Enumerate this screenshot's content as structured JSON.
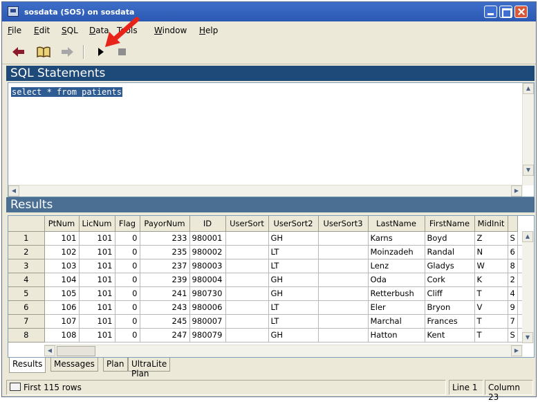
{
  "window": {
    "title": "sosdata (SOS) on sosdata"
  },
  "menu": [
    "File",
    "Edit",
    "SQL",
    "Data",
    "Tools",
    "Window",
    "Help"
  ],
  "toolbar": {
    "icons": [
      "back-arrow-icon",
      "book-icon",
      "forward-arrow-icon",
      "play-icon",
      "stop-icon"
    ]
  },
  "sql_panel": {
    "title": "SQL Statements",
    "query": "select * from patients"
  },
  "results_panel": {
    "title": "Results",
    "columns": [
      "PtNum",
      "LicNum",
      "Flag",
      "PayorNum",
      "ID",
      "UserSort",
      "UserSort2",
      "UserSort3",
      "LastName",
      "FirstName",
      "MidInit",
      ""
    ],
    "rows": [
      {
        "n": "1",
        "cells": [
          "101",
          "101",
          "0",
          "233",
          "980001",
          "",
          "GH",
          "",
          "Karns",
          "Boyd",
          "Z",
          "S"
        ]
      },
      {
        "n": "2",
        "cells": [
          "102",
          "101",
          "0",
          "235",
          "980002",
          "",
          "LT",
          "",
          "Moinzadeh",
          "Randal",
          "N",
          "6"
        ]
      },
      {
        "n": "3",
        "cells": [
          "103",
          "101",
          "0",
          "237",
          "980003",
          "",
          "LT",
          "",
          "Lenz",
          "Gladys",
          "W",
          "8"
        ]
      },
      {
        "n": "4",
        "cells": [
          "104",
          "101",
          "0",
          "239",
          "980004",
          "",
          "GH",
          "",
          "Oda",
          "Cork",
          "K",
          "2"
        ]
      },
      {
        "n": "5",
        "cells": [
          "105",
          "101",
          "0",
          "241",
          "980730",
          "",
          "GH",
          "",
          "Retterbush",
          "Cliff",
          "T",
          "4"
        ]
      },
      {
        "n": "6",
        "cells": [
          "106",
          "101",
          "0",
          "243",
          "980006",
          "",
          "LT",
          "",
          "Eler",
          "Bryon",
          "V",
          "9"
        ]
      },
      {
        "n": "7",
        "cells": [
          "107",
          "101",
          "0",
          "245",
          "980007",
          "",
          "LT",
          "",
          "Marchal",
          "Frances",
          "T",
          "7"
        ]
      },
      {
        "n": "8",
        "cells": [
          "108",
          "101",
          "0",
          "247",
          "980079",
          "",
          "GH",
          "",
          "Hatton",
          "Kent",
          "T",
          "S"
        ]
      }
    ],
    "tabs": [
      "Results",
      "Messages",
      "Plan",
      "UltraLite Plan"
    ]
  },
  "status": {
    "rows": "First 115 rows",
    "line": "Line 1",
    "column": "Column 23"
  },
  "colors": {
    "title_bar": "#2b58b2",
    "section_header": "#1e4a7a",
    "selection": "#2e5b92",
    "annotation": "#e8231a"
  }
}
